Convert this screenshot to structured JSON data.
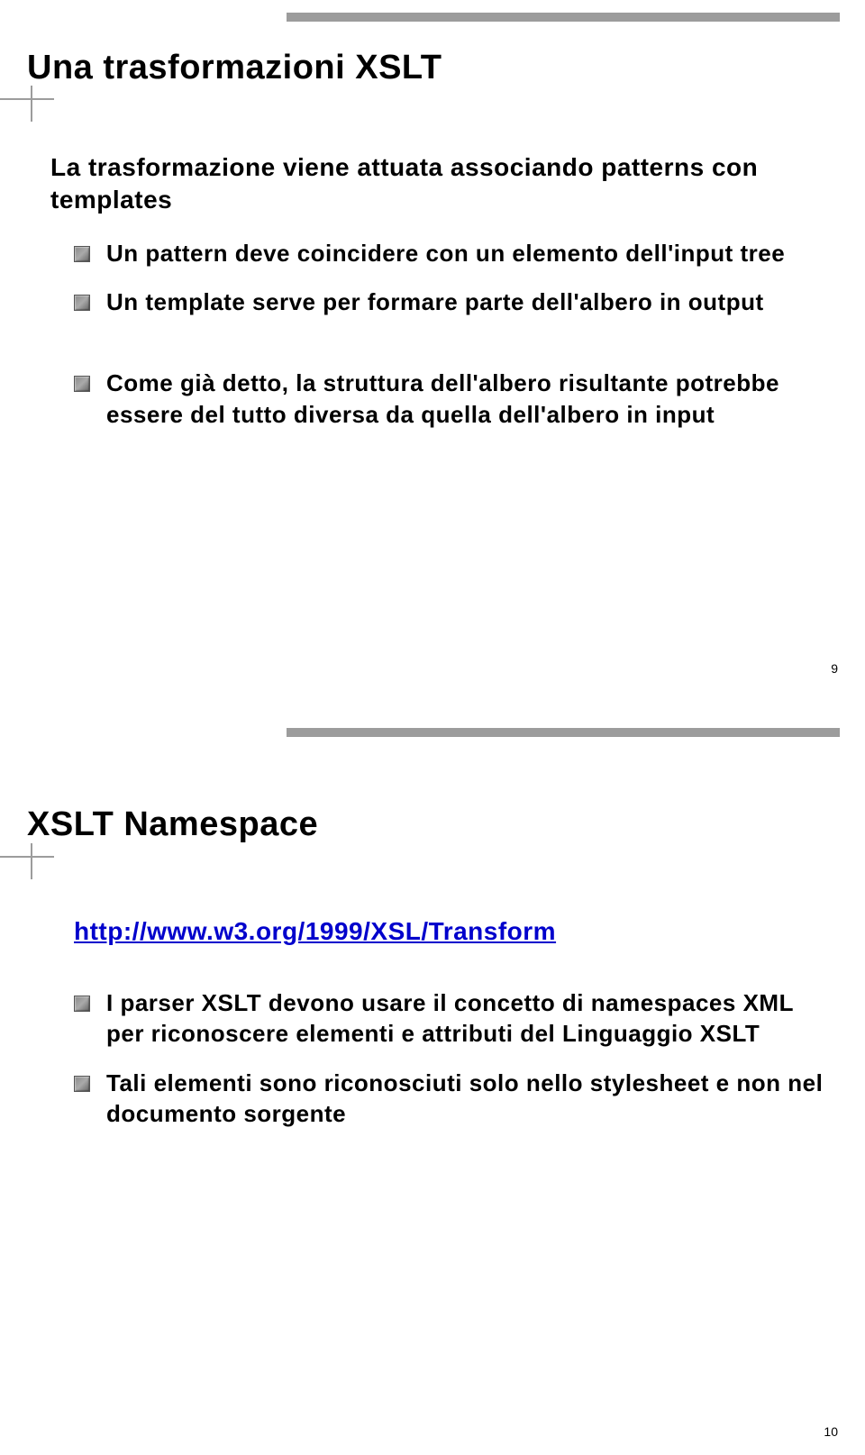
{
  "slide1": {
    "title": "Una trasformazioni XSLT",
    "subtitle": "La trasformazione viene attuata associando patterns con templates",
    "bullets_a": [
      "Un pattern deve coincidere con un elemento dell'input tree",
      "Un template serve per formare parte dell'albero in output"
    ],
    "bullets_b": [
      "Come già detto, la struttura dell'albero risultante potrebbe essere del tutto diversa da quella dell'albero in input"
    ],
    "page": "9"
  },
  "slide2": {
    "title": "XSLT Namespace",
    "link": "http://www.w3.org/1999/XSL/Transform",
    "bullets": [
      "I parser XSLT devono usare il concetto di namespaces XML per riconoscere elementi e attributi del Linguaggio XSLT",
      "Tali elementi sono riconosciuti solo nello stylesheet e non nel documento sorgente"
    ],
    "page": "10"
  }
}
